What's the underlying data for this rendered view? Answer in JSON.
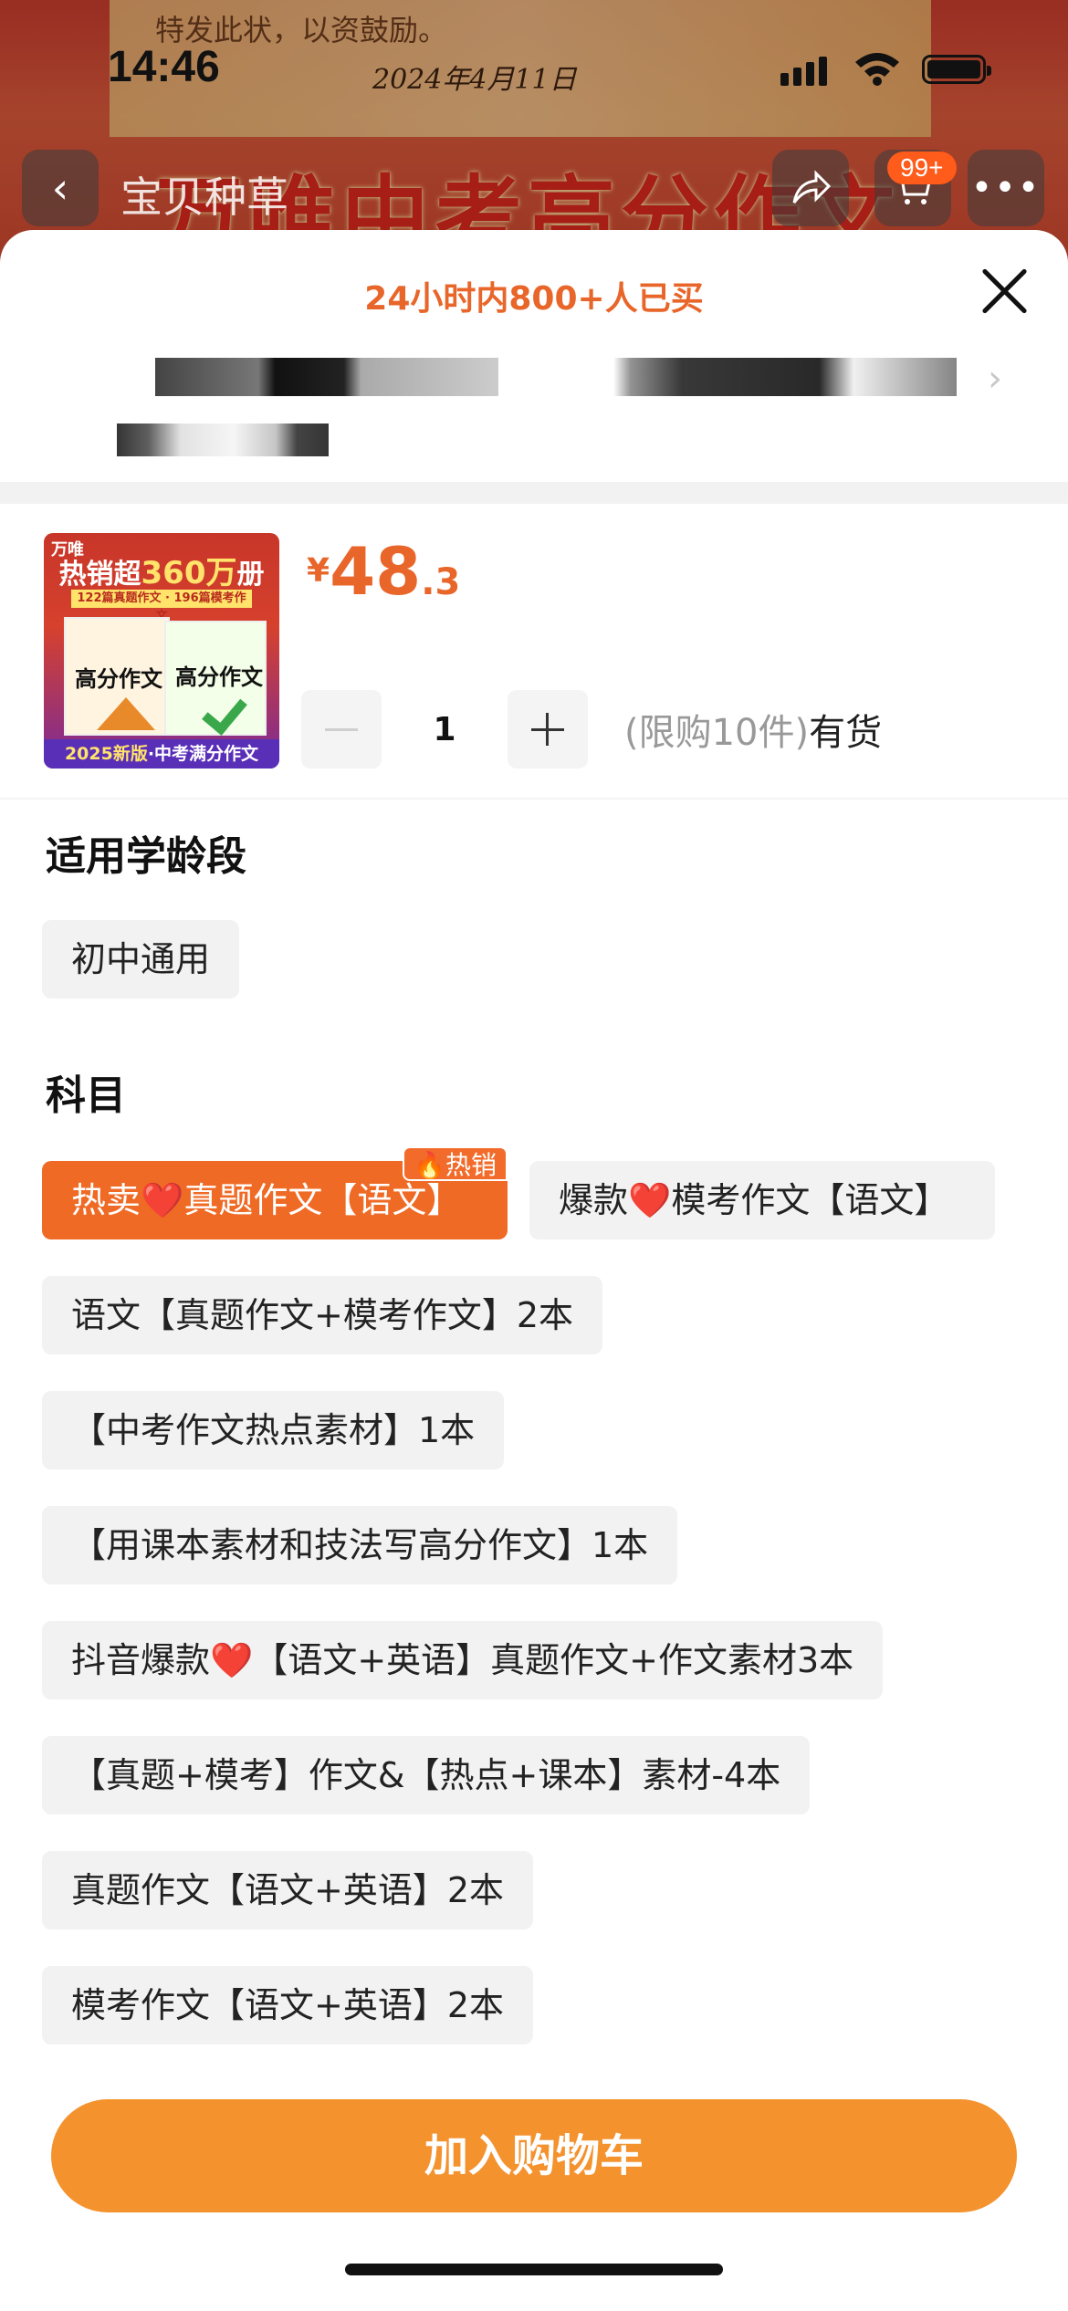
{
  "status_bar": {
    "time": "14:46"
  },
  "background": {
    "certificate_text": "特发此状，以资鼓励。",
    "certificate_date": "2024年4月11日",
    "banner_text": "万唯中考高分作文"
  },
  "nav": {
    "back_icon": "chevron-left-icon",
    "title": "宝贝种草",
    "share_icon": "share-icon",
    "cart_icon": "cart-icon",
    "cart_badge": "99+",
    "more_icon": "more-dots-icon"
  },
  "sheet": {
    "sold_tip": "24小时内800+人已买",
    "close_icon": "close-icon",
    "address_arrow": "›",
    "product": {
      "cover": {
        "brand": "万唯",
        "headline_prefix": "热销超",
        "headline_number": "360万",
        "headline_suffix": "册",
        "sub": "122篇真题作文 · 196篇模考作文",
        "book1_title": "高分作文",
        "book2_title": "高分作文",
        "footer_year": "2025新版",
        "footer_text": "·中考满分作文"
      },
      "price": {
        "currency": "¥",
        "integer": "48",
        "decimal": ".3"
      },
      "quantity": "1",
      "limit_text": "(限购10件)",
      "stock_text": "有货"
    },
    "age_section": {
      "title": "适用学龄段",
      "options": [
        "初中通用"
      ]
    },
    "subject_section": {
      "title": "科目",
      "hot_tag": "热销",
      "options": [
        "热卖❤️真题作文【语文】",
        "爆款❤️模考作文【语文】",
        "语文【真题作文+模考作文】2本",
        "【中考作文热点素材】1本",
        "【用课本素材和技法写高分作文】1本",
        "抖音爆款❤️【语文+英语】真题作文+作文素材3本",
        "【真题+模考】作文&【热点+课本】素材-4本",
        "真题作文【语文+英语】2本",
        "模考作文【语文+英语】2本"
      ],
      "selected_index": 0
    },
    "cta": "加入购物车"
  },
  "colors": {
    "accent": "#ef6a25",
    "cta": "#f4922e",
    "chip_bg": "#f2f2f2"
  }
}
